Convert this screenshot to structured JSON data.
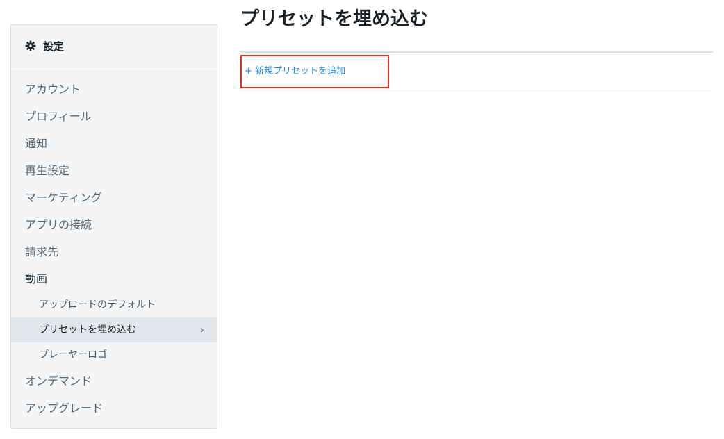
{
  "page_title": "プリセットを埋め込む",
  "sidebar": {
    "title": "設定",
    "items": [
      {
        "label": "アカウント"
      },
      {
        "label": "プロフィール"
      },
      {
        "label": "通知"
      },
      {
        "label": "再生設定"
      },
      {
        "label": "マーケティング"
      },
      {
        "label": "アプリの接続"
      },
      {
        "label": "請求先"
      },
      {
        "label": "動画"
      }
    ],
    "sub_items": [
      {
        "label": "アップロードのデフォルト"
      },
      {
        "label": "プリセットを埋め込む",
        "active": true
      },
      {
        "label": "プレーヤーロゴ"
      }
    ],
    "items_after": [
      {
        "label": "オンデマンド"
      },
      {
        "label": "アップグレード"
      }
    ]
  },
  "main": {
    "add_preset_label": "+ 新規プリセットを追加"
  },
  "colors": {
    "link": "#1f8fd6",
    "highlight": "#e0301e",
    "sidebar_bg": "#f3f5f6",
    "active_bg": "#e3e7e9"
  },
  "icons": {
    "header": "gear-icon",
    "active_indicator": "chevron-right-icon"
  }
}
